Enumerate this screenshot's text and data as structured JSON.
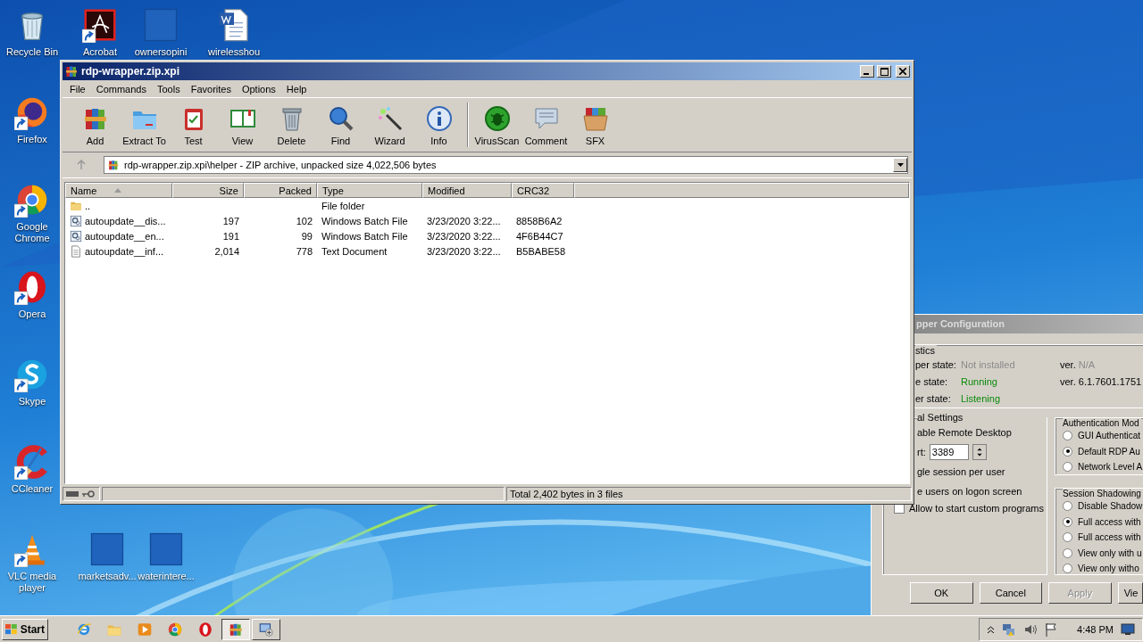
{
  "desktop": {
    "icons": [
      {
        "label": "Recycle Bin",
        "kind": "recycle",
        "shortcut": false
      },
      {
        "label": "Acrobat",
        "kind": "pdf",
        "shortcut": true
      },
      {
        "label": "ownersopini",
        "kind": "blank",
        "shortcut": false
      },
      {
        "label": "wirelesshou",
        "kind": "word",
        "shortcut": false
      },
      {
        "label": "Firefox",
        "kind": "firefox",
        "shortcut": true
      },
      {
        "label": "Google Chrome",
        "kind": "chrome",
        "shortcut": true
      },
      {
        "label": "Opera",
        "kind": "opera",
        "shortcut": true
      },
      {
        "label": "Skype",
        "kind": "skype",
        "shortcut": true
      },
      {
        "label": "CCleaner",
        "kind": "ccleaner",
        "shortcut": true
      },
      {
        "label": "VLC media player",
        "kind": "vlc",
        "shortcut": true
      },
      {
        "label": "marketsadv...",
        "kind": "blank",
        "shortcut": false
      },
      {
        "label": "waterintere...",
        "kind": "blank",
        "shortcut": false
      }
    ]
  },
  "config_window": {
    "title": "pper Configuration",
    "diagnostics": {
      "label": "stics",
      "rows": [
        {
          "label": "per state:",
          "value": "Not installed",
          "color": "#8a8a8a",
          "version": {
            "prefix": "ver.",
            "value": "N/A",
            "color": "#8a8a8a"
          }
        },
        {
          "label": "e state:",
          "value": "Running",
          "color": "#0b8a0b",
          "version": {
            "prefix": "ver.",
            "value": "6.1.7601.1751"
          }
        },
        {
          "label": "er state:",
          "value": "Listening",
          "color": "#0b8a0b"
        }
      ]
    },
    "general": {
      "label": "al Settings",
      "enable": "able Remote Desktop",
      "port_label": "rt:",
      "port": "3389",
      "single_session": "gle session per user",
      "hide_users": "e users on logon screen",
      "custom_programs": {
        "label": "Allow to start custom programs",
        "checked": false
      }
    },
    "authentication": {
      "label": "Authentication Mod",
      "options": [
        {
          "label": "GUI Authenticat",
          "selected": false
        },
        {
          "label": "Default RDP Au",
          "selected": true
        },
        {
          "label": "Network Level A",
          "selected": false
        }
      ]
    },
    "shadowing": {
      "label": "Session Shadowing",
      "options": [
        {
          "label": "Disable Shadow",
          "selected": false
        },
        {
          "label": "Full access with",
          "selected": true
        },
        {
          "label": "Full access with",
          "selected": false
        },
        {
          "label": "View only with u",
          "selected": false
        },
        {
          "label": "View only witho",
          "selected": false
        }
      ]
    },
    "buttons": [
      {
        "label": "OK",
        "disabled": false
      },
      {
        "label": "Cancel",
        "disabled": false
      },
      {
        "label": "Apply",
        "disabled": true
      },
      {
        "label": "Vie",
        "disabled": false
      }
    ]
  },
  "archive_window": {
    "title": "rdp-wrapper.zip.xpi",
    "menu": [
      "File",
      "Commands",
      "Tools",
      "Favorites",
      "Options",
      "Help"
    ],
    "toolbar_groups": [
      [
        {
          "label": "Add",
          "kind": "add"
        },
        {
          "label": "Extract To",
          "kind": "extract"
        },
        {
          "label": "Test",
          "kind": "test"
        },
        {
          "label": "View",
          "kind": "view"
        },
        {
          "label": "Delete",
          "kind": "delete"
        },
        {
          "label": "Find",
          "kind": "find"
        },
        {
          "label": "Wizard",
          "kind": "wizard"
        },
        {
          "label": "Info",
          "kind": "info"
        }
      ],
      [
        {
          "label": "VirusScan",
          "kind": "virusscan"
        },
        {
          "label": "Comment",
          "kind": "comment"
        },
        {
          "label": "SFX",
          "kind": "sfx"
        }
      ]
    ],
    "address": "rdp-wrapper.zip.xpi\\helper - ZIP archive, unpacked size 4,022,506 bytes",
    "columns": [
      "Name",
      "Size",
      "Packed",
      "Type",
      "Modified",
      "CRC32"
    ],
    "rows": [
      {
        "kind": "folder",
        "name": "..",
        "size": null,
        "packed": null,
        "type": "File folder",
        "modified": null,
        "crc32": null
      },
      {
        "kind": "batch",
        "name": "autoupdate__dis...",
        "size": "197",
        "packed": "102",
        "type": "Windows Batch File",
        "modified": "3/23/2020 3:22...",
        "crc32": "8858B6A2"
      },
      {
        "kind": "batch",
        "name": "autoupdate__en...",
        "size": "191",
        "packed": "99",
        "type": "Windows Batch File",
        "modified": "3/23/2020 3:22...",
        "crc32": "4F6B44C7"
      },
      {
        "kind": "text",
        "name": "autoupdate__inf...",
        "size": "2,014",
        "packed": "778",
        "type": "Text Document",
        "modified": "3/23/2020 3:22...",
        "crc32": "B5BABE58"
      }
    ],
    "status": "Total 2,402 bytes in 3 files"
  },
  "taskbar": {
    "start": "Start",
    "apps": [
      {
        "kind": "ie",
        "selected": false
      },
      {
        "kind": "explorer",
        "selected": false
      },
      {
        "kind": "media",
        "selected": false
      },
      {
        "kind": "chrome",
        "selected": false
      },
      {
        "kind": "opera",
        "selected": false
      },
      {
        "kind": "add",
        "selected": true
      },
      {
        "kind": "rdp",
        "selected": false
      }
    ],
    "clock": "4:48 PM"
  }
}
